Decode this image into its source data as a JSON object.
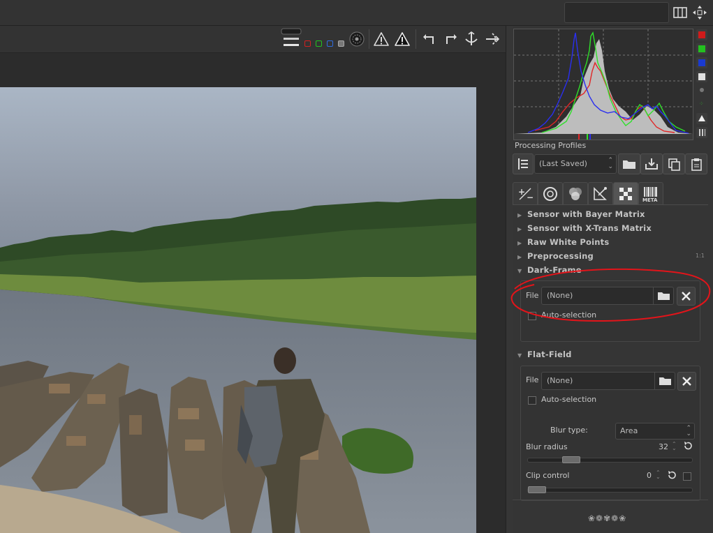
{
  "histogram": {
    "buttons": [
      {
        "name": "red-channel-toggle",
        "color": "#d01b1b"
      },
      {
        "name": "green-channel-toggle",
        "color": "#23c01f"
      },
      {
        "name": "blue-channel-toggle",
        "color": "#1a3ad0"
      },
      {
        "name": "luminance-toggle",
        "color": "#e0e0e0"
      }
    ]
  },
  "colors": {
    "red_curve": "#e12626",
    "green_curve": "#2fe02a",
    "blue_curve": "#2a2ef0",
    "annotation": "#e3141a"
  },
  "profiles": {
    "title": "Processing Profiles",
    "selected": "(Last Saved)"
  },
  "tabs": [
    {
      "icon": "exposure-icon"
    },
    {
      "icon": "detail-icon"
    },
    {
      "icon": "color-icon"
    },
    {
      "icon": "transform-icon"
    },
    {
      "icon": "raw-icon"
    },
    {
      "icon": "metadata-icon",
      "label": "META"
    }
  ],
  "sections": {
    "bayer": "Sensor with Bayer Matrix",
    "xtrans": "Sensor with X-Trans Matrix",
    "white_points": "Raw White Points",
    "preprocessing": "Preprocessing",
    "preprocessing_badge": "1:1",
    "dark_frame": "Dark-Frame",
    "flat_field": "Flat-Field"
  },
  "dark_frame": {
    "file_label": "File",
    "file_value": "(None)",
    "auto_selection": "Auto-selection"
  },
  "flat_field": {
    "file_label": "File",
    "file_value": "(None)",
    "auto_selection": "Auto-selection",
    "blur_type_label": "Blur type:",
    "blur_type_value": "Area",
    "blur_radius_label": "Blur radius",
    "blur_radius_value": "32",
    "blur_radius_fraction": 0.23,
    "clip_control_label": "Clip control",
    "clip_control_value": "0",
    "clip_control_fraction": 0.0
  }
}
